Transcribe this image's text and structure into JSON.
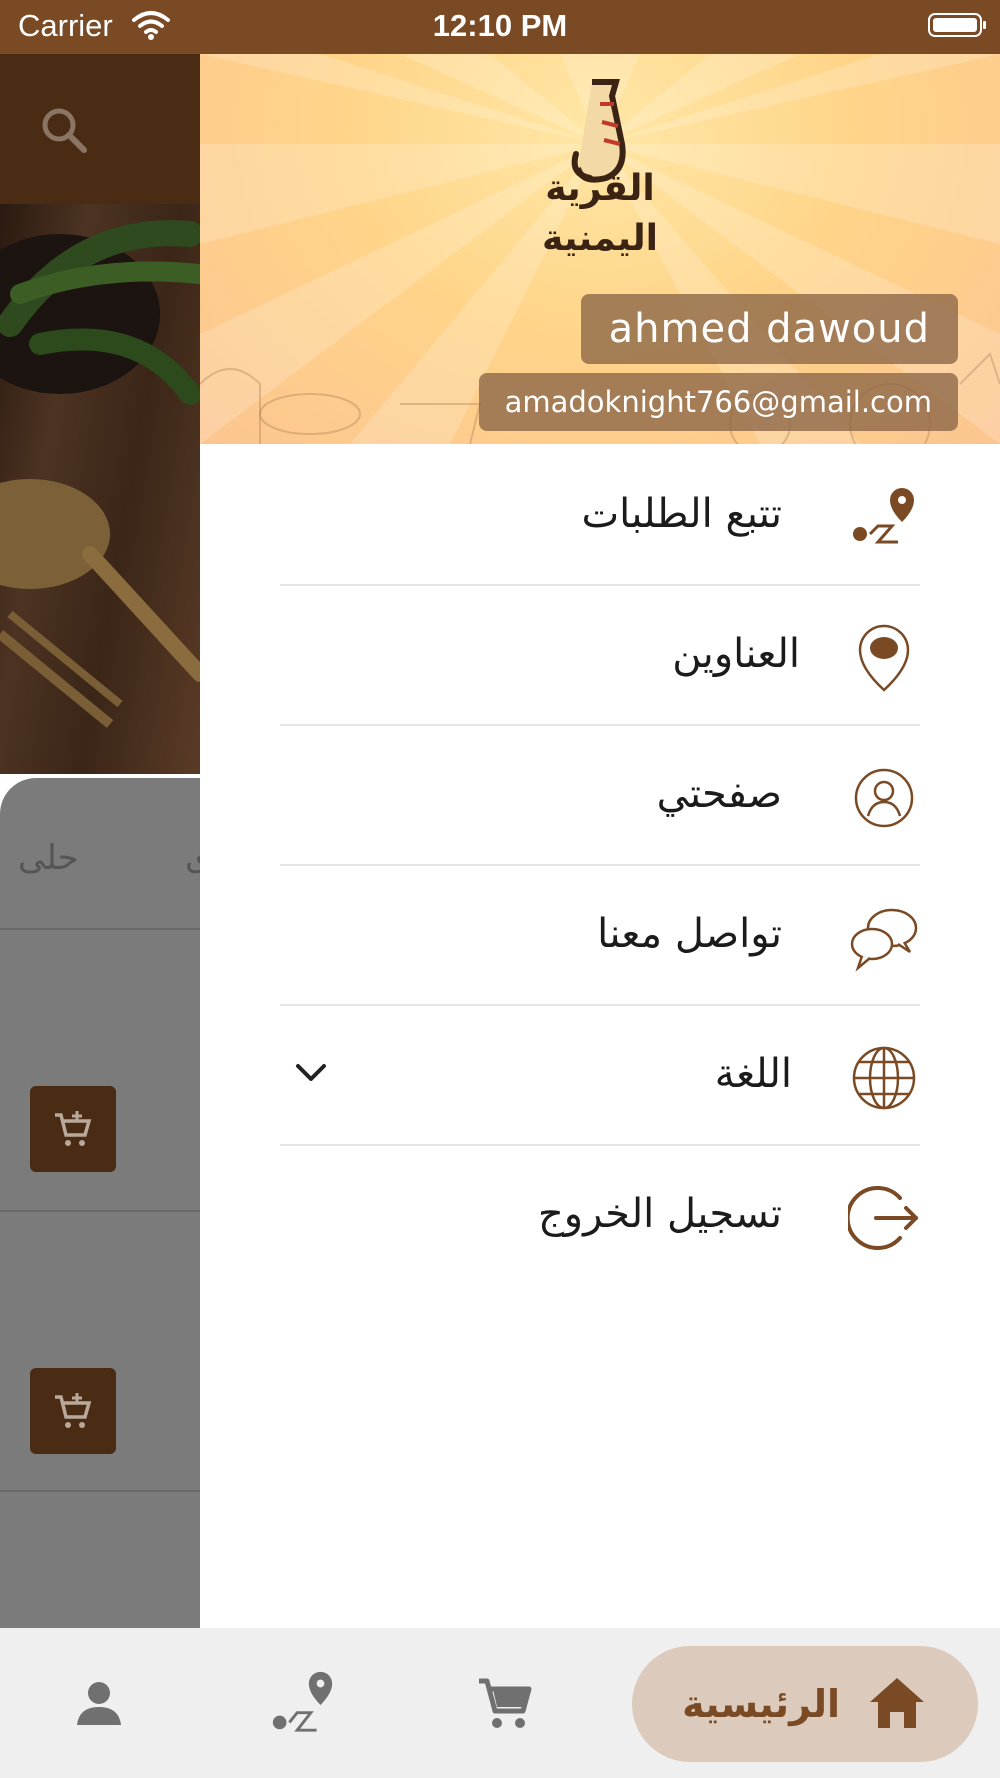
{
  "status_bar": {
    "carrier": "Carrier",
    "time": "12:10 PM"
  },
  "background_page": {
    "tab_visible": "حلى"
  },
  "drawer": {
    "brand": {
      "line1": "القرية",
      "line2": "اليمنية"
    },
    "user": {
      "name": "ahmed dawoud",
      "email": "amadoknight766@gmail.com"
    },
    "menu": [
      {
        "label": "تتبع الطلبات",
        "icon": "route-pin-icon"
      },
      {
        "label": "العناوين",
        "icon": "location-pin-icon"
      },
      {
        "label": "صفحتي",
        "icon": "user-circle-icon"
      },
      {
        "label": "تواصل معنا",
        "icon": "chat-bubbles-icon"
      },
      {
        "label": "اللغة",
        "icon": "globe-icon"
      },
      {
        "label": "تسجيل الخروج",
        "icon": "logout-icon"
      }
    ]
  },
  "bottom_nav": {
    "home_label": "الرئيسية",
    "items": [
      "profile-icon",
      "route-pin-icon",
      "cart-icon",
      "home-icon"
    ]
  },
  "colors": {
    "brand_brown": "#7a4a25",
    "dark_brown": "#4a2b14",
    "accent_bg": "#dccbbd"
  }
}
